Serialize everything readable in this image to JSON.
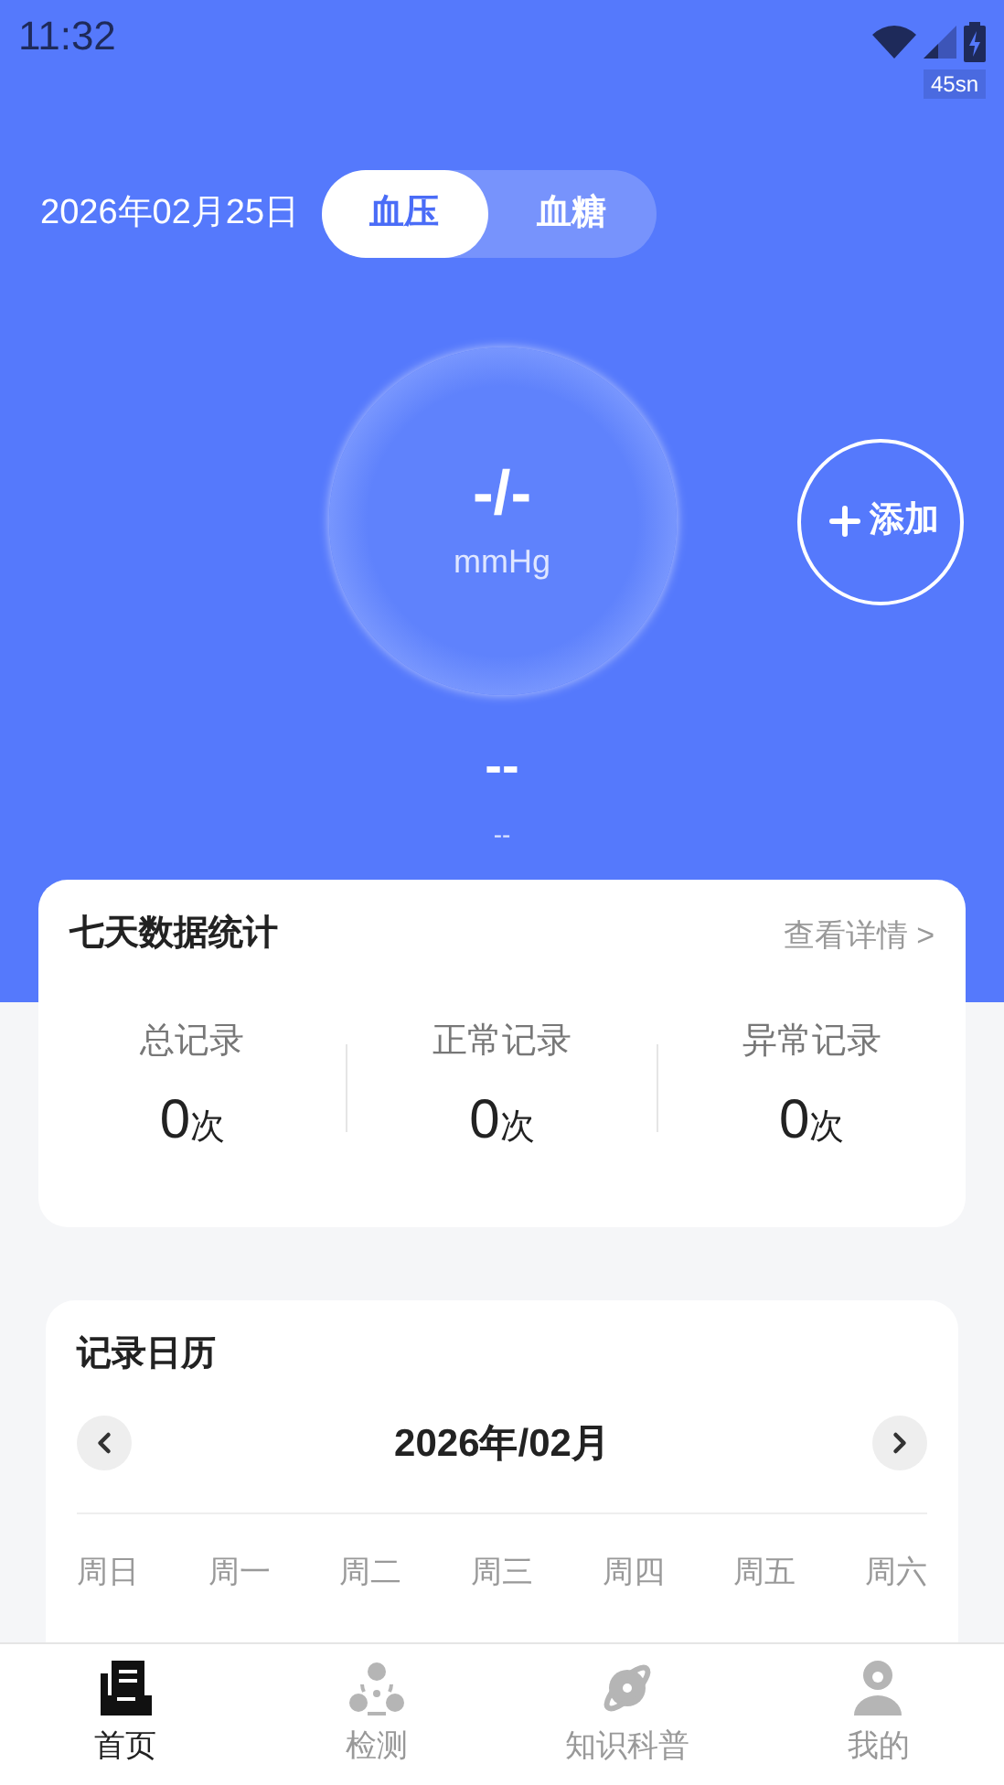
{
  "status_bar": {
    "time": "11:32",
    "badge": "45sn"
  },
  "header": {
    "date": "2026年02月25日",
    "tabs": [
      {
        "label": "血压",
        "selected": true
      },
      {
        "label": "血糖",
        "selected": false
      }
    ]
  },
  "reading": {
    "value": "-/-",
    "unit": "mmHg",
    "status": "--",
    "note": "--"
  },
  "add_button": {
    "label": "添加"
  },
  "stats": {
    "title": "七天数据统计",
    "link": "查看详情 >",
    "items": [
      {
        "label": "总记录",
        "value": "0",
        "unit": "次"
      },
      {
        "label": "正常记录",
        "value": "0",
        "unit": "次"
      },
      {
        "label": "异常记录",
        "value": "0",
        "unit": "次"
      }
    ]
  },
  "calendar": {
    "title": "记录日历",
    "month": "2026年/02月",
    "weekdays": [
      "周日",
      "周一",
      "周二",
      "周三",
      "周四",
      "周五",
      "周六"
    ]
  },
  "nav": [
    {
      "label": "首页",
      "selected": true,
      "kind": "home"
    },
    {
      "label": "检测",
      "selected": false,
      "kind": "detect"
    },
    {
      "label": "知识科普",
      "selected": false,
      "kind": "knowledge"
    },
    {
      "label": "我的",
      "selected": false,
      "kind": "profile"
    }
  ]
}
